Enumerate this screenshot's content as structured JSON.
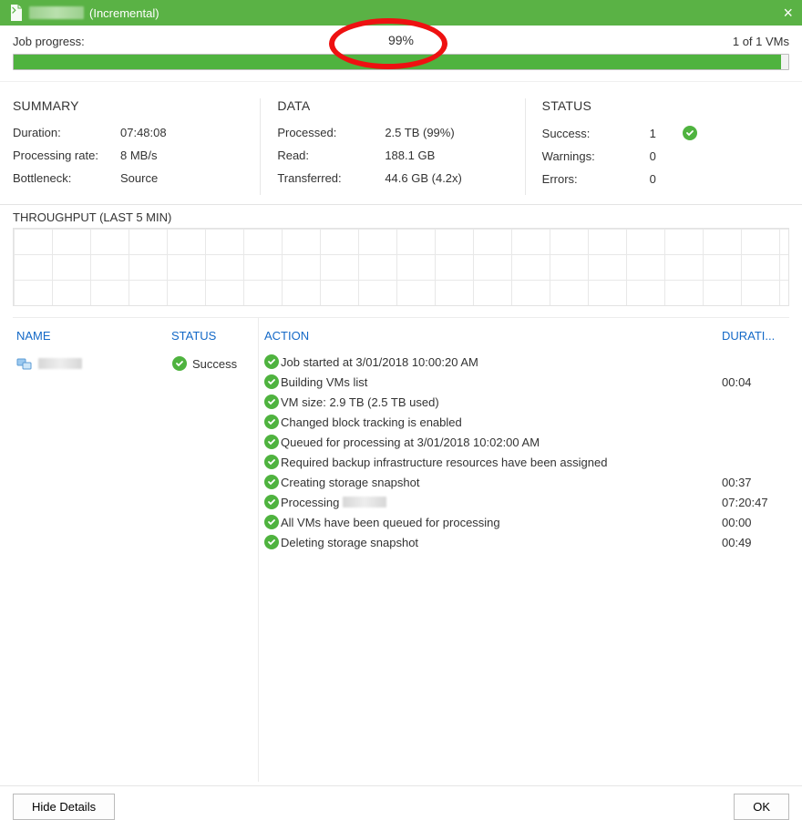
{
  "titlebar": {
    "suffix": "(Incremental)"
  },
  "progress": {
    "label": "Job progress:",
    "percent_text": "99%",
    "percent_value": 99,
    "right_text": "1 of 1 VMs"
  },
  "summary": {
    "heading": "SUMMARY",
    "duration_label": "Duration:",
    "duration_value": "07:48:08",
    "rate_label": "Processing rate:",
    "rate_value": "8 MB/s",
    "bottleneck_label": "Bottleneck:",
    "bottleneck_value": "Source"
  },
  "data": {
    "heading": "DATA",
    "processed_label": "Processed:",
    "processed_value": "2.5 TB (99%)",
    "read_label": "Read:",
    "read_value": "188.1 GB",
    "transferred_label": "Transferred:",
    "transferred_value": "44.6 GB (4.2x)"
  },
  "status": {
    "heading": "STATUS",
    "success_label": "Success:",
    "success_value": "1",
    "warnings_label": "Warnings:",
    "warnings_value": "0",
    "errors_label": "Errors:",
    "errors_value": "0"
  },
  "throughput": {
    "heading": "THROUGHPUT (LAST 5 MIN)"
  },
  "pane_left": {
    "header_name": "NAME",
    "header_status": "STATUS",
    "row_status": "Success"
  },
  "pane_right": {
    "header_action": "ACTION",
    "header_duration": "DURATI...",
    "actions": [
      {
        "text": "Job started at 3/01/2018 10:00:20 AM",
        "duration": ""
      },
      {
        "text": "Building VMs list",
        "duration": "00:04"
      },
      {
        "text": "VM size: 2.9 TB (2.5 TB used)",
        "duration": ""
      },
      {
        "text": "Changed block tracking is enabled",
        "duration": ""
      },
      {
        "text": "Queued for processing at 3/01/2018 10:02:00 AM",
        "duration": ""
      },
      {
        "text": "Required backup infrastructure resources have been assigned",
        "duration": ""
      },
      {
        "text": "Creating storage snapshot",
        "duration": "00:37"
      },
      {
        "text": "Processing",
        "duration": "07:20:47",
        "blurred_after": true
      },
      {
        "text": "All VMs have been queued for processing",
        "duration": "00:00"
      },
      {
        "text": "Deleting storage snapshot",
        "duration": "00:49"
      }
    ]
  },
  "footer": {
    "hide_details": "Hide Details",
    "ok": "OK"
  }
}
